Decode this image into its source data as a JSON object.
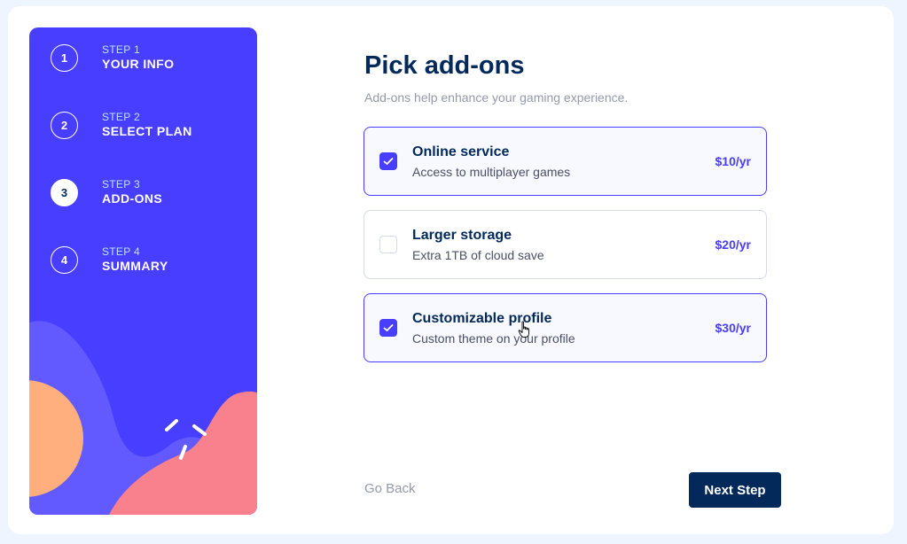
{
  "sidebar": {
    "steps": [
      {
        "number": "1",
        "label": "STEP 1",
        "title": "YOUR INFO",
        "active": false
      },
      {
        "number": "2",
        "label": "STEP 2",
        "title": "SELECT PLAN",
        "active": false
      },
      {
        "number": "3",
        "label": "STEP 3",
        "title": "ADD-ONS",
        "active": true
      },
      {
        "number": "4",
        "label": "STEP 4",
        "title": "SUMMARY",
        "active": false
      }
    ]
  },
  "main": {
    "title": "Pick add-ons",
    "subtitle": "Add-ons help enhance your gaming experience."
  },
  "addons": [
    {
      "name": "Online service",
      "description": "Access to multiplayer games",
      "price": "$10/yr",
      "checked": true
    },
    {
      "name": "Larger storage",
      "description": "Extra 1TB of cloud save",
      "price": "$20/yr",
      "checked": false
    },
    {
      "name": "Customizable profile",
      "description": "Custom theme on your profile",
      "price": "$30/yr",
      "checked": true
    }
  ],
  "footer": {
    "back_label": "Go Back",
    "next_label": "Next Step"
  },
  "colors": {
    "accent": "#483eff",
    "marine": "#022959",
    "grey": "#9699aa",
    "border": "#d6d9e6"
  },
  "icons": {
    "check": "check-icon",
    "cursor": "hand-pointer-icon"
  }
}
